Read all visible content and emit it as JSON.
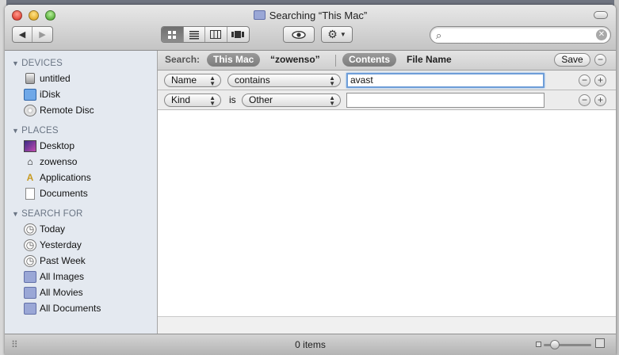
{
  "window": {
    "title": "Searching “This Mac”"
  },
  "toolbar": {
    "back_icon": "back-arrow-icon",
    "forward_icon": "forward-arrow-icon",
    "views": [
      "icon-view",
      "list-view",
      "column-view",
      "coverflow-view"
    ],
    "active_view": "icon-view",
    "search_placeholder": "",
    "search_value": ""
  },
  "sidebar": {
    "devices": {
      "heading": "DEVICES",
      "items": [
        {
          "label": "untitled",
          "icon": "hard-disk-icon"
        },
        {
          "label": "iDisk",
          "icon": "idisk-icon"
        },
        {
          "label": "Remote Disc",
          "icon": "disc-icon"
        }
      ]
    },
    "places": {
      "heading": "PLACES",
      "items": [
        {
          "label": "Desktop",
          "icon": "desktop-icon"
        },
        {
          "label": "zowenso",
          "icon": "home-icon"
        },
        {
          "label": "Applications",
          "icon": "applications-icon"
        },
        {
          "label": "Documents",
          "icon": "documents-icon"
        }
      ]
    },
    "search_for": {
      "heading": "SEARCH FOR",
      "items": [
        {
          "label": "Today",
          "icon": "clock-icon"
        },
        {
          "label": "Yesterday",
          "icon": "clock-icon"
        },
        {
          "label": "Past Week",
          "icon": "clock-icon"
        },
        {
          "label": "All Images",
          "icon": "smart-folder-icon"
        },
        {
          "label": "All Movies",
          "icon": "smart-folder-icon"
        },
        {
          "label": "All Documents",
          "icon": "smart-folder-icon"
        }
      ]
    }
  },
  "scope_bar": {
    "label": "Search:",
    "location_selected": "This Mac",
    "location_other": "“zowenso”",
    "attribute_selected": "Contents",
    "attribute_other": "File Name",
    "save_label": "Save"
  },
  "criteria": [
    {
      "attribute": "Name",
      "operator": "contains",
      "value": "avast"
    },
    {
      "attribute": "Kind",
      "connector": "is",
      "operator": "Other",
      "value": ""
    }
  ],
  "status": {
    "text": "0 items"
  }
}
